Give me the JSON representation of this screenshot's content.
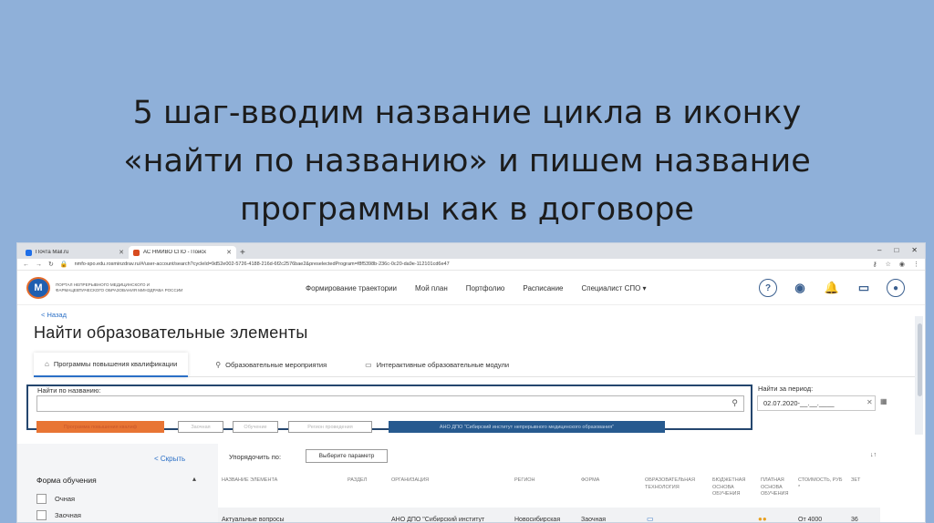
{
  "slide": {
    "title_lines": [
      "5 шаг-вводим название цикла в иконку",
      "«найти по названию» и пишем название",
      "программы как в договоре"
    ]
  },
  "browser": {
    "tabs": [
      {
        "label": "Почта Mail.ru",
        "icon": "mail-favicon"
      },
      {
        "label": "АС НМИВО СПО - Поиск",
        "icon": "as-favicon"
      }
    ],
    "new_tab": "+",
    "controls": [
      "–",
      "□",
      "✕"
    ],
    "url": "nmfo-spo.edu.rosminzdrav.ru/#/user-account/search?cycleId=9d52e002-5726-4188-216d-6f2c2576bae2&preselectedProgram=f8f5398b-236c-0c20-da9e-112101cd6e47"
  },
  "site": {
    "logo_text": "ПОРТАЛ НЕПРЕРЫВНОГО МЕДИЦИНСКОГО И ФАРМАЦЕВТИЧЕСКОГО ОБРАЗОВАНИЯ МИНЗДРАВА РОССИИ",
    "nav": [
      "Формирование траектории",
      "Мой план",
      "Портфолио",
      "Расписание",
      "Специалист СПО ▾"
    ],
    "header_icons": [
      "help-icon",
      "eye-icon",
      "bell-icon",
      "chat-icon",
      "profile-icon"
    ]
  },
  "page": {
    "back": "< Назад",
    "title": "Найти образовательные элементы",
    "tabs": [
      {
        "label": "Программы повышения квалификации",
        "icon": "building-icon"
      },
      {
        "label": "Образовательные мероприятия",
        "icon": "pin-icon"
      },
      {
        "label": "Интерактивные образовательные модули",
        "icon": "monitor-icon"
      }
    ]
  },
  "search": {
    "label": "Найти по названию:",
    "value": "",
    "period_label": "Найти за период:",
    "period_value": "02.07.2020-__.__.____"
  },
  "filters": {
    "chip1": "Программа повышения квалиф",
    "chip2": "Заочная",
    "chip3": "Обучение",
    "chip4": "Регион проведения",
    "chip5": "АНО ДПО \"Сибирский институт непрерывного медицинского образования\""
  },
  "sidebar": {
    "collapse": "< Скрыть",
    "group_title": "Форма обучения",
    "options": [
      "Очная",
      "Заочная"
    ]
  },
  "sort": {
    "label": "Упорядочить по:",
    "select": "Выберите параметр"
  },
  "table": {
    "headers": [
      "Название элемента",
      "Раздел",
      "Организация",
      "Регион",
      "Форма",
      "Образовательная технология",
      "Бюджетная основа обучения",
      "Платная основа обучения",
      "Стоимость, руб *",
      "ЗЕТ"
    ],
    "row": {
      "name": "Актуальные вопросы",
      "org": "АНО ДПО \"Сибирский институт",
      "region": "Новосибирская",
      "form": "Заочная",
      "cost": "От 4000",
      "zet": "36"
    }
  }
}
